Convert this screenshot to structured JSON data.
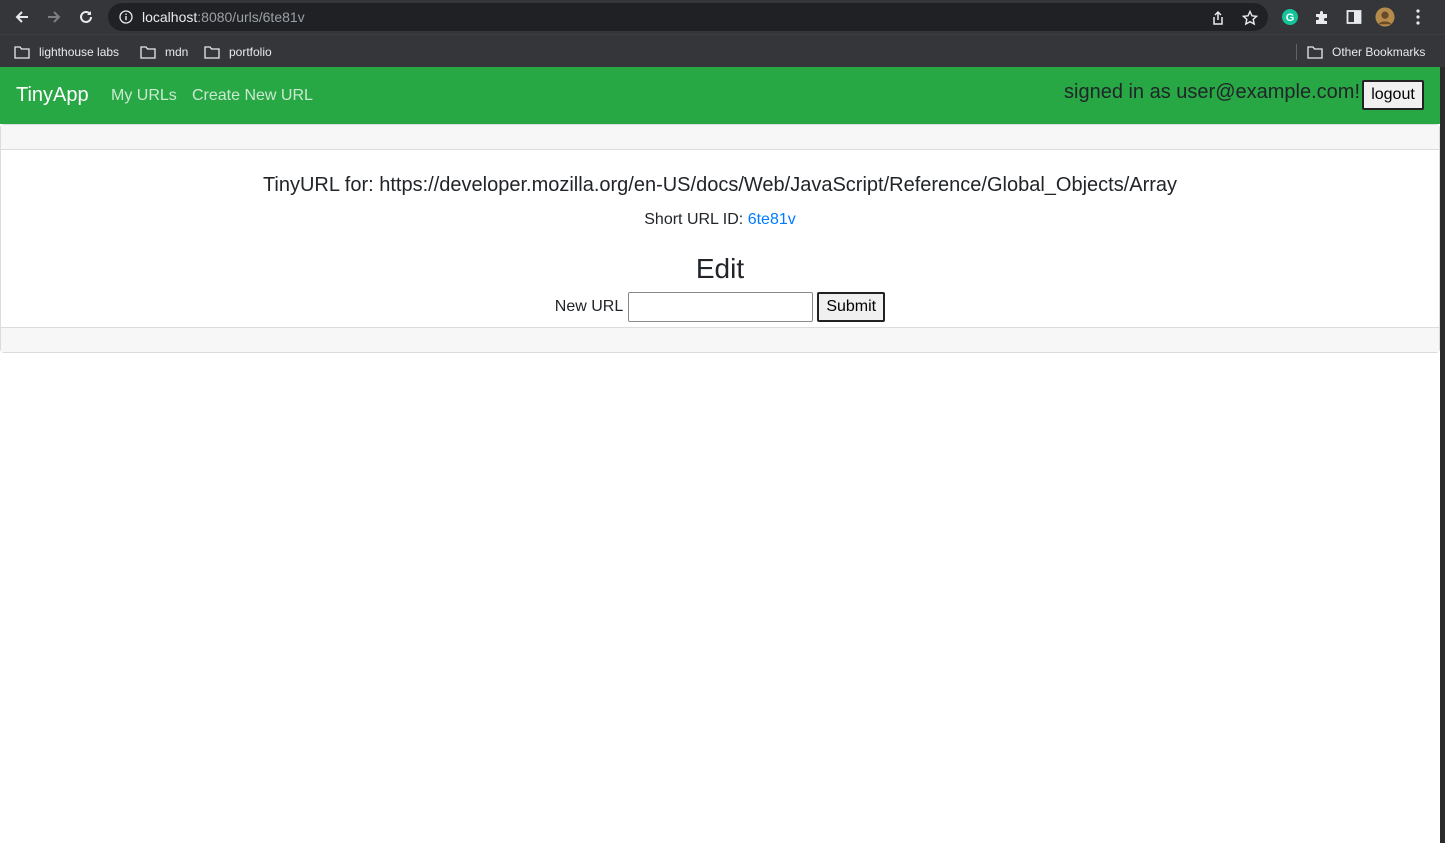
{
  "browser": {
    "url_host": "localhost",
    "url_rest": ":8080/urls/6te81v",
    "bookmarks": [
      {
        "label": "lighthouse labs"
      },
      {
        "label": "mdn"
      },
      {
        "label": "portfolio"
      }
    ],
    "other_bookmarks": "Other Bookmarks",
    "icons": {
      "back": "arrow-left-icon",
      "forward": "arrow-right-icon",
      "reload": "reload-icon",
      "info": "info-icon",
      "share": "share-icon",
      "star": "star-icon",
      "grammarly": "grammarly-icon",
      "extensions": "puzzle-icon",
      "side_panel": "side-panel-icon",
      "avatar": "avatar-icon",
      "menu": "kebab-menu-icon",
      "folder": "folder-icon"
    }
  },
  "navbar": {
    "brand": "TinyApp",
    "links": [
      {
        "label": "My URLs"
      },
      {
        "label": "Create New URL"
      }
    ],
    "signed_in": "signed in as user@example.com!",
    "logout_label": "logout",
    "color": "#28a745"
  },
  "main": {
    "title": "TinyURL for: https://developer.mozilla.org/en-US/docs/Web/JavaScript/Reference/Global_Objects/Array",
    "short_url_label": "Short URL ID:",
    "short_url_id": "6te81v",
    "edit_heading": "Edit",
    "new_url_label": "New URL",
    "new_url_value": "",
    "submit_label": "Submit",
    "link_color": "#007bff"
  }
}
